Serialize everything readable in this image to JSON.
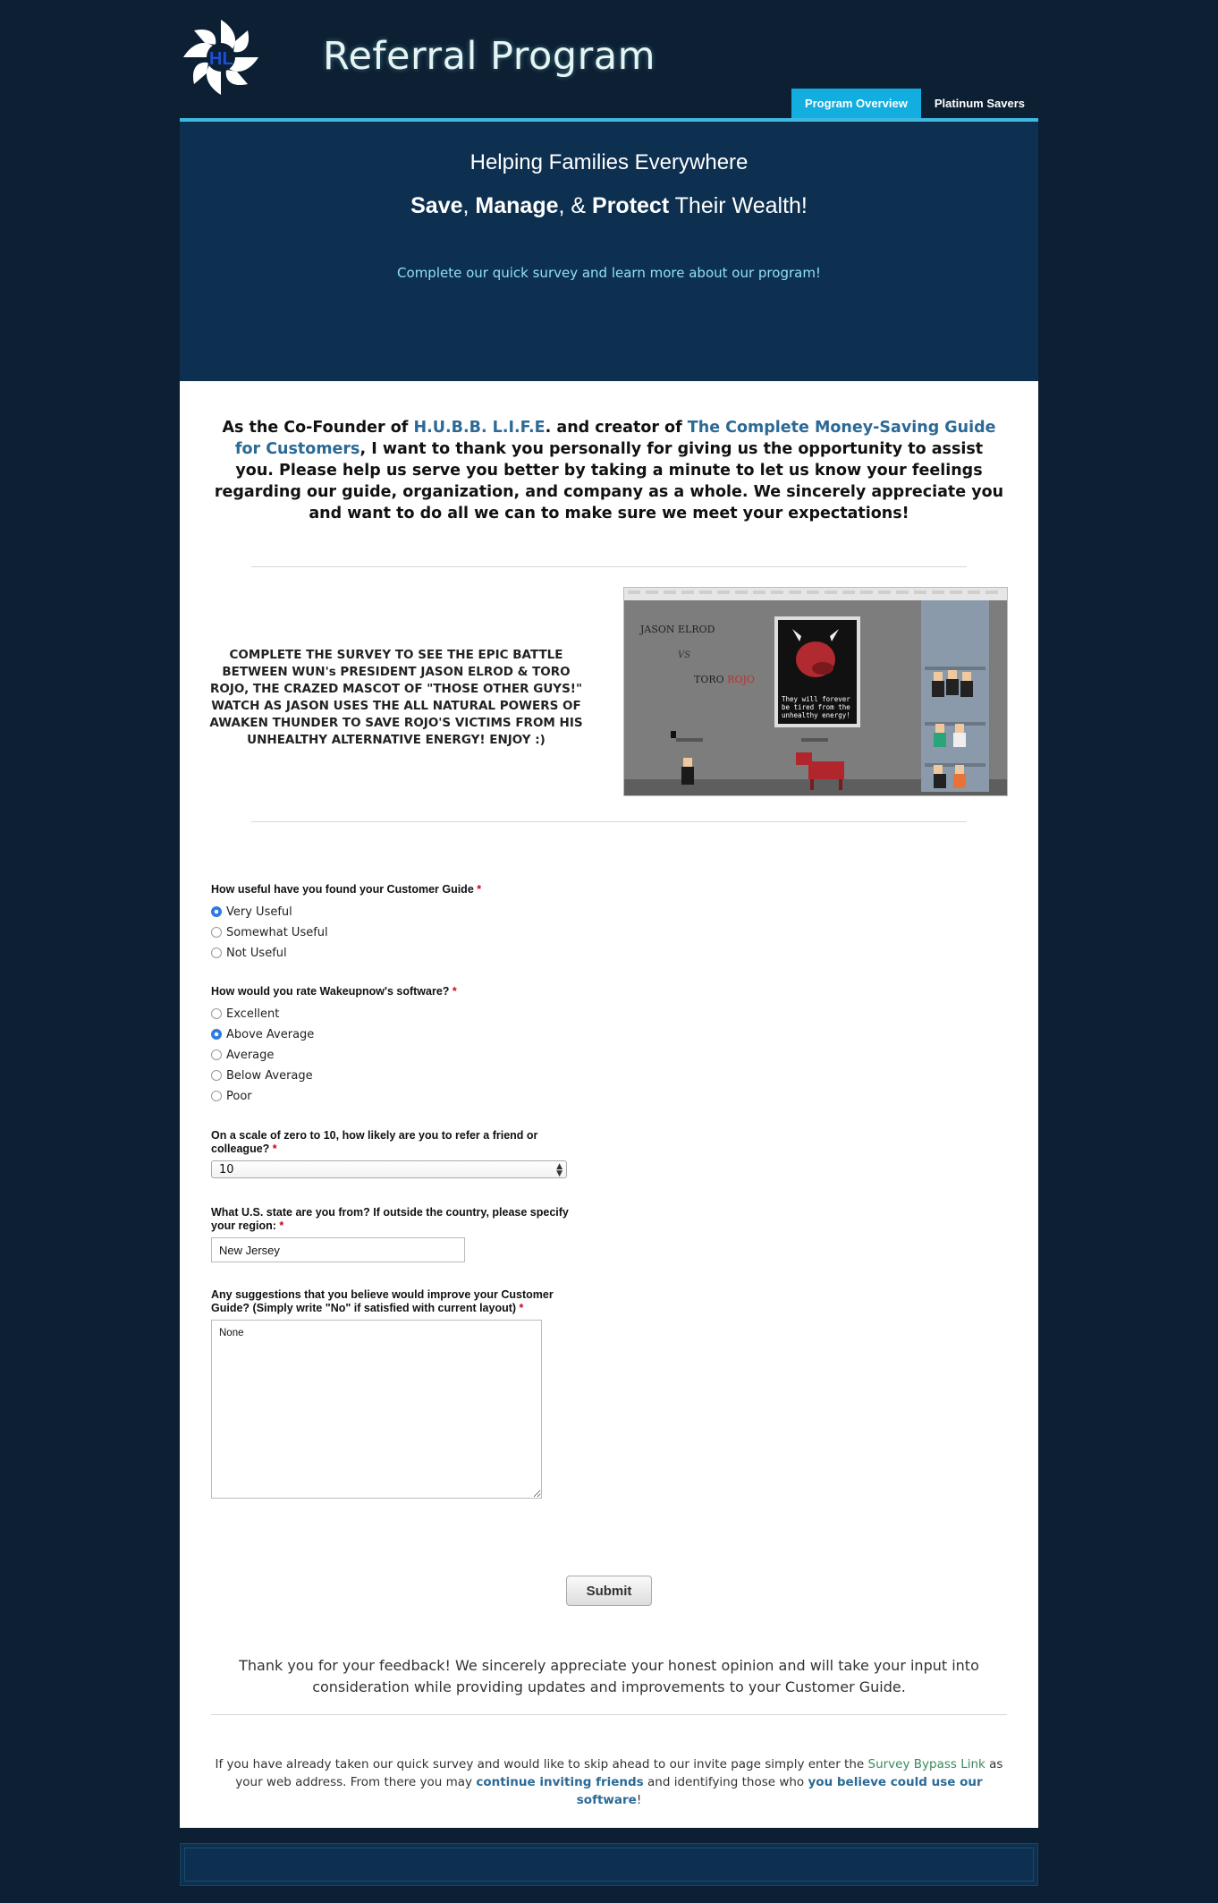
{
  "header": {
    "logo_initials": "HL",
    "title": "Referral Program",
    "tabs": [
      {
        "label": "Program Overview",
        "active": true
      },
      {
        "label": "Platinum Savers",
        "active": false
      }
    ],
    "accent_color": "#12aee0"
  },
  "hero": {
    "line1": "Helping Families Everywhere",
    "line2_save": "Save",
    "line2_sep1": ", ",
    "line2_manage": "Manage",
    "line2_sep2": ", & ",
    "line2_protect": "Protect",
    "line2_rest": " Their Wealth!",
    "subtitle": "Complete our quick survey and learn more about our program!"
  },
  "intro": {
    "part1": "As the Co-Founder of ",
    "link1": "H.U.B.B. L.I.F.E",
    "part2": ". and creator of ",
    "link2": "The Complete Money-Saving Guide for Customers",
    "part3": ", I want to thank you personally for giving us the opportunity to assist you. Please help us serve you better by taking a minute to let us know your feelings regarding our guide, organization, and company as a whole. We sincerely appreciate you and want to do all we can to make sure we meet your expectations!"
  },
  "battle": {
    "text": "COMPLETE THE SURVEY TO SEE THE EPIC BATTLE BETWEEN WUN's PRESIDENT JASON ELROD & TORO ROJO, THE CRAZED MASCOT OF \"THOSE OTHER GUYS!\" WATCH AS JASON USES THE ALL NATURAL POWERS OF AWAKEN THUNDER TO SAVE ROJO'S VICTIMS FROM HIS UNHEALTHY ALTERNATIVE ENERGY! ENJOY :)",
    "scene": {
      "name1": "JASON ELROD",
      "vs": "VS",
      "name2a": "TORO ",
      "name2b": "ROJO",
      "poster_text": "They will forever be tired from the unhealthy energy!"
    }
  },
  "survey": {
    "required_mark": "*",
    "q1": {
      "label": "How useful have you found your Customer Guide",
      "options": [
        "Very Useful",
        "Somewhat Useful",
        "Not Useful"
      ],
      "selected": 0
    },
    "q2": {
      "label": "How would you rate Wakeupnow's software?",
      "options": [
        "Excellent",
        "Above Average",
        "Average",
        "Below Average",
        "Poor"
      ],
      "selected": 1
    },
    "q3": {
      "label": "On a scale of zero to 10, how likely are you to refer a friend or colleague?",
      "value": "10"
    },
    "q4": {
      "label": "What U.S. state are you from? If outside the country, please specify your region:",
      "value": "New Jersey"
    },
    "q5": {
      "label": "Any suggestions that you believe would improve your Customer Guide? (Simply write \"No\" if satisfied with current layout)",
      "value": "None"
    },
    "submit_label": "Submit"
  },
  "thanks": "Thank you for your feedback! We sincerely appreciate your honest opinion and will take your input into consideration while providing updates and improvements to your Customer Guide.",
  "bypass": {
    "part1": "If you have already taken our quick survey and would like to skip ahead to our invite page simply enter the ",
    "link1": "Survey Bypass Link",
    "part2": " as your web address. From there you may ",
    "link2": "continue inviting friends",
    "part3": " and identifying those who ",
    "link3": "you believe could use our software",
    "part4": "!"
  }
}
